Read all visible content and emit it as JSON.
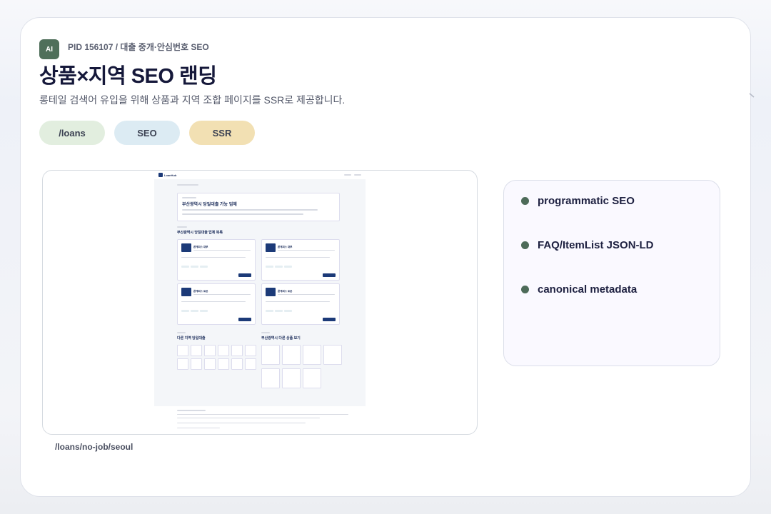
{
  "header": {
    "badge": "AI",
    "pid": "PID 156107 / 대출 중개·안심번호 SEO",
    "title": "상품×지역 SEO 랜딩",
    "subtitle": "롱테일 검색어 유입을 위해 상품과 지역 조합 페이지를 SSR로 제공합니다."
  },
  "chips": [
    {
      "label": "/loans",
      "color": "#e2eedf"
    },
    {
      "label": "SEO",
      "color": "#dcebf3"
    },
    {
      "label": "SSR",
      "color": "#f2e0b3"
    }
  ],
  "preview": {
    "route": "/loans/no-job/seoul",
    "mini": {
      "logo": "LoanHub",
      "hero_title": "부산광역시 당일대출 가능 업체",
      "section_title": "부산광역시 당일대출 업체 목록",
      "card_names": [
        "론캐피스 대부",
        "론캐피스 대부",
        "론캐피스 로몬",
        "론캐피스 로몬"
      ],
      "other_regions_title": "다른 지역 당일대출",
      "other_products_title": "부산광역시 다른 상품 보기"
    }
  },
  "features": [
    {
      "label": "programmatic SEO"
    },
    {
      "label": "FAQ/ItemList JSON-LD"
    },
    {
      "label": "canonical metadata"
    }
  ],
  "colors": {
    "accent": "#4f6f5a",
    "navy": "#1c3a78"
  }
}
